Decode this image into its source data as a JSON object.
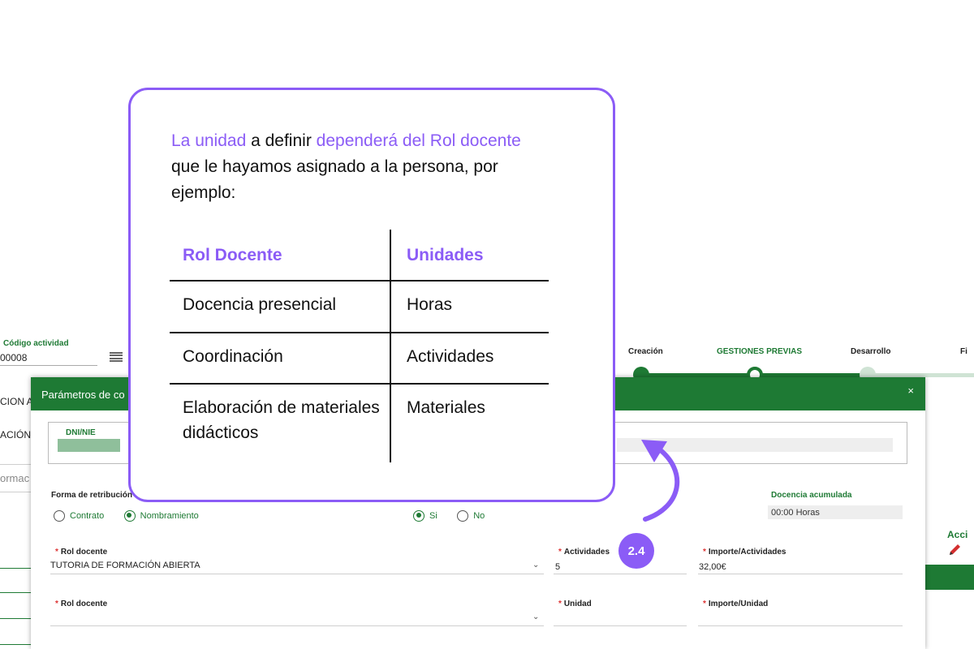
{
  "app": {
    "codigo_label": "Código actividad",
    "codigo_value": "00008",
    "cut_label_1": "CION A",
    "cut_label_2": "ACIÓN I",
    "cut_label_3": "ormac",
    "acciones_label": "Acci"
  },
  "steps": [
    {
      "label": "Creación",
      "state": "done"
    },
    {
      "label": "GESTIONES PREVIAS",
      "state": "active"
    },
    {
      "label": "Desarrollo",
      "state": "pending"
    },
    {
      "label": "Fi",
      "state": "pending"
    }
  ],
  "modal": {
    "title": "Parámetros de co",
    "close": "×",
    "dni_label": "DNI/NIE",
    "forma_label": "Forma de retribución",
    "forma_options": [
      {
        "label": "Contrato",
        "checked": false
      },
      {
        "label": "Nombramiento",
        "checked": true
      }
    ],
    "si_no_options": [
      {
        "label": "Si",
        "checked": true
      },
      {
        "label": "No",
        "checked": false
      }
    ],
    "docencia_label": "Docencia acumulada",
    "docencia_value": "00:00 Horas",
    "rol1_label": "Rol docente",
    "rol1_value": "TUTORIA DE FORMACIÓN ABIERTA",
    "actividades_label": "Actividades",
    "actividades_value": "5",
    "importe_act_label": "Importe/Actividades",
    "importe_act_value": "32,00€",
    "rol2_label": "Rol docente",
    "unidad_label": "Unidad",
    "importe_unidad_label": "Importe/Unidad",
    "required_mark": "*"
  },
  "card": {
    "intro_hl1": "La unidad",
    "intro_t1": " a definir ",
    "intro_hl2": "dependerá del Rol docente",
    "intro_t2": " que le hayamos asignado a la persona, por ejemplo:",
    "col_rol": "Rol Docente",
    "col_unidades": "Unidades",
    "rows": [
      {
        "rol": "Docencia presencial",
        "unidad": "Horas"
      },
      {
        "rol": "Coordinación",
        "unidad": "Actividades"
      },
      {
        "rol": "Elaboración de materiales didácticos",
        "unidad": "Materiales"
      }
    ]
  },
  "badge": "2.4",
  "colors": {
    "accent": "#8b5cf6",
    "green": "#1e7a34",
    "required": "#dd3333"
  }
}
